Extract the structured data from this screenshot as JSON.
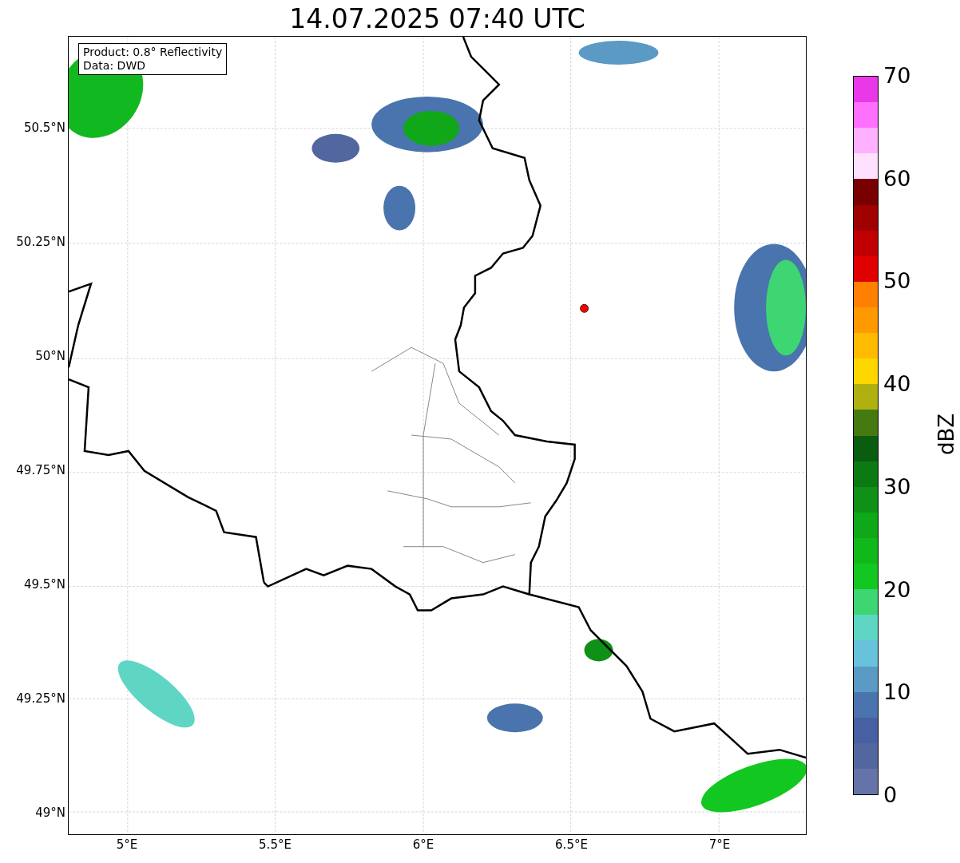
{
  "title": "14.07.2025 07:40 UTC",
  "info_box": [
    "Product: 0.8° Reflectivity",
    "Data: DWD"
  ],
  "y_ticks": [
    "50.5°N",
    "50.25°N",
    "50°N",
    "49.75°N",
    "49.5°N",
    "49.25°N",
    "49°N"
  ],
  "x_ticks": [
    "5°E",
    "5.5°E",
    "6°E",
    "6.5°E",
    "7°E"
  ],
  "colorbar": {
    "label": "dBZ",
    "ticks": [
      "70",
      "60",
      "50",
      "40",
      "30",
      "20",
      "10",
      "0"
    ],
    "bins": [
      {
        "color": "#e838e8"
      },
      {
        "color": "#ff70ff"
      },
      {
        "color": "#ffb0ff"
      },
      {
        "color": "#ffe0ff"
      },
      {
        "color": "#780000"
      },
      {
        "color": "#a00000"
      },
      {
        "color": "#c00000"
      },
      {
        "color": "#e00000"
      },
      {
        "color": "#ff8000"
      },
      {
        "color": "#ff9900"
      },
      {
        "color": "#ffbb00"
      },
      {
        "color": "#ffd700"
      },
      {
        "color": "#b0b010"
      },
      {
        "color": "#457a10"
      },
      {
        "color": "#0a5c0e"
      },
      {
        "color": "#0c7a12"
      },
      {
        "color": "#0e9116"
      },
      {
        "color": "#0fa818"
      },
      {
        "color": "#10b81a"
      },
      {
        "color": "#12c820"
      },
      {
        "color": "#3dd673"
      },
      {
        "color": "#5fd6c4"
      },
      {
        "color": "#68c2dc"
      },
      {
        "color": "#5a9ac4"
      },
      {
        "color": "#4a74ad"
      },
      {
        "color": "#4660a2"
      },
      {
        "color": "#52679f"
      },
      {
        "color": "#6474a8"
      }
    ]
  }
}
